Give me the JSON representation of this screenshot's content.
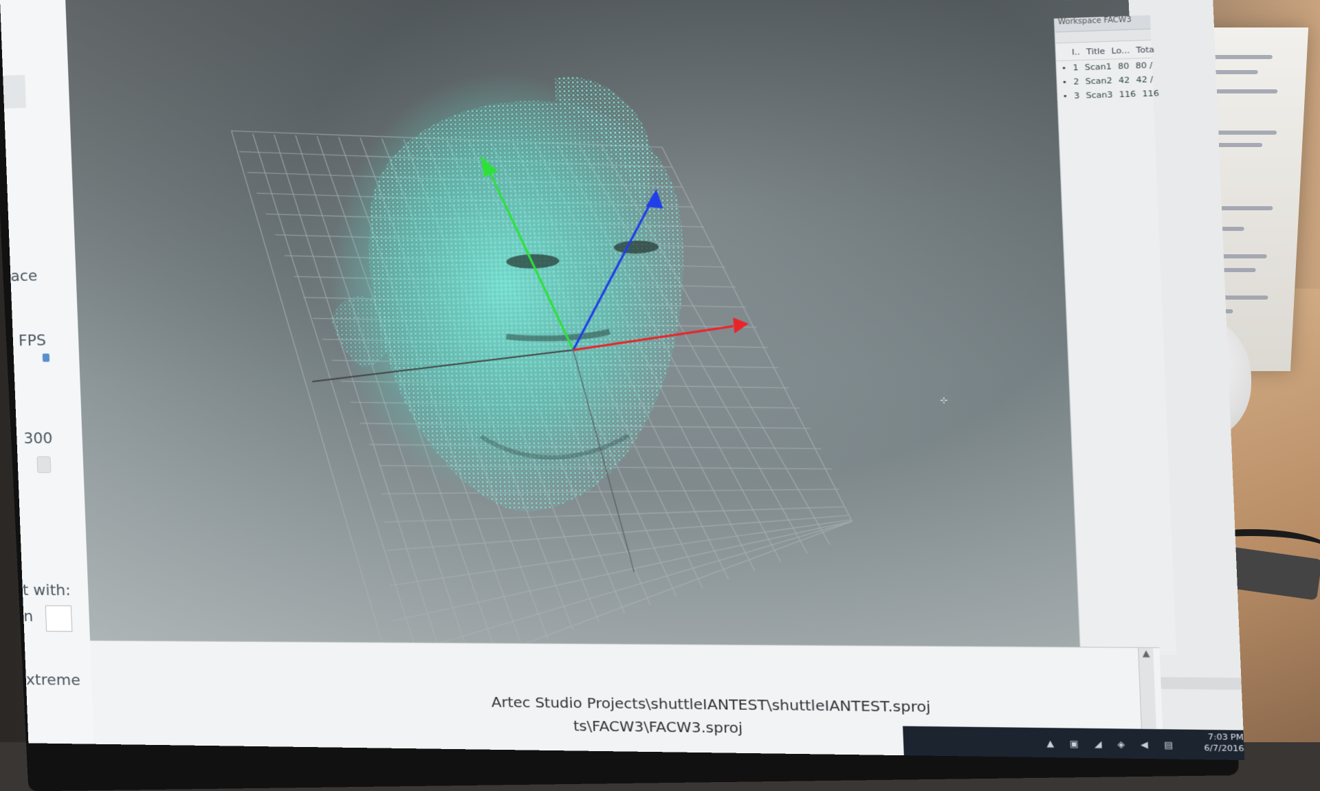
{
  "left_panel": {
    "fragments": [
      "ace",
      "FPS",
      "300",
      "t with:",
      "xtreme"
    ],
    "stepper_value": "n"
  },
  "window_controls": [
    "–",
    "□",
    "×"
  ],
  "side_list": {
    "header": "Workspace   FACW3",
    "columns": [
      "I..",
      "Title",
      "Lo...",
      "Tota"
    ],
    "rows": [
      {
        "index": "1",
        "title": "Scan1",
        "lo": "80",
        "total": "80 /"
      },
      {
        "index": "2",
        "title": "Scan2",
        "lo": "42",
        "total": "42 /"
      },
      {
        "index": "3",
        "title": "Scan3",
        "lo": "116",
        "total": "116"
      }
    ]
  },
  "log": {
    "line1": "Artec Studio Projects\\shuttleIANTEST\\shuttleIANTEST.sproj",
    "line2": "ts\\FACW3\\FACW3.sproj"
  },
  "taskbar": {
    "time": "7:03 PM",
    "date": "6/7/2016"
  },
  "axis_colors": {
    "x": "#e8242a",
    "y": "#2fe03a",
    "z": "#1f3fe8"
  },
  "point_cloud_color": "#6fe0d2"
}
